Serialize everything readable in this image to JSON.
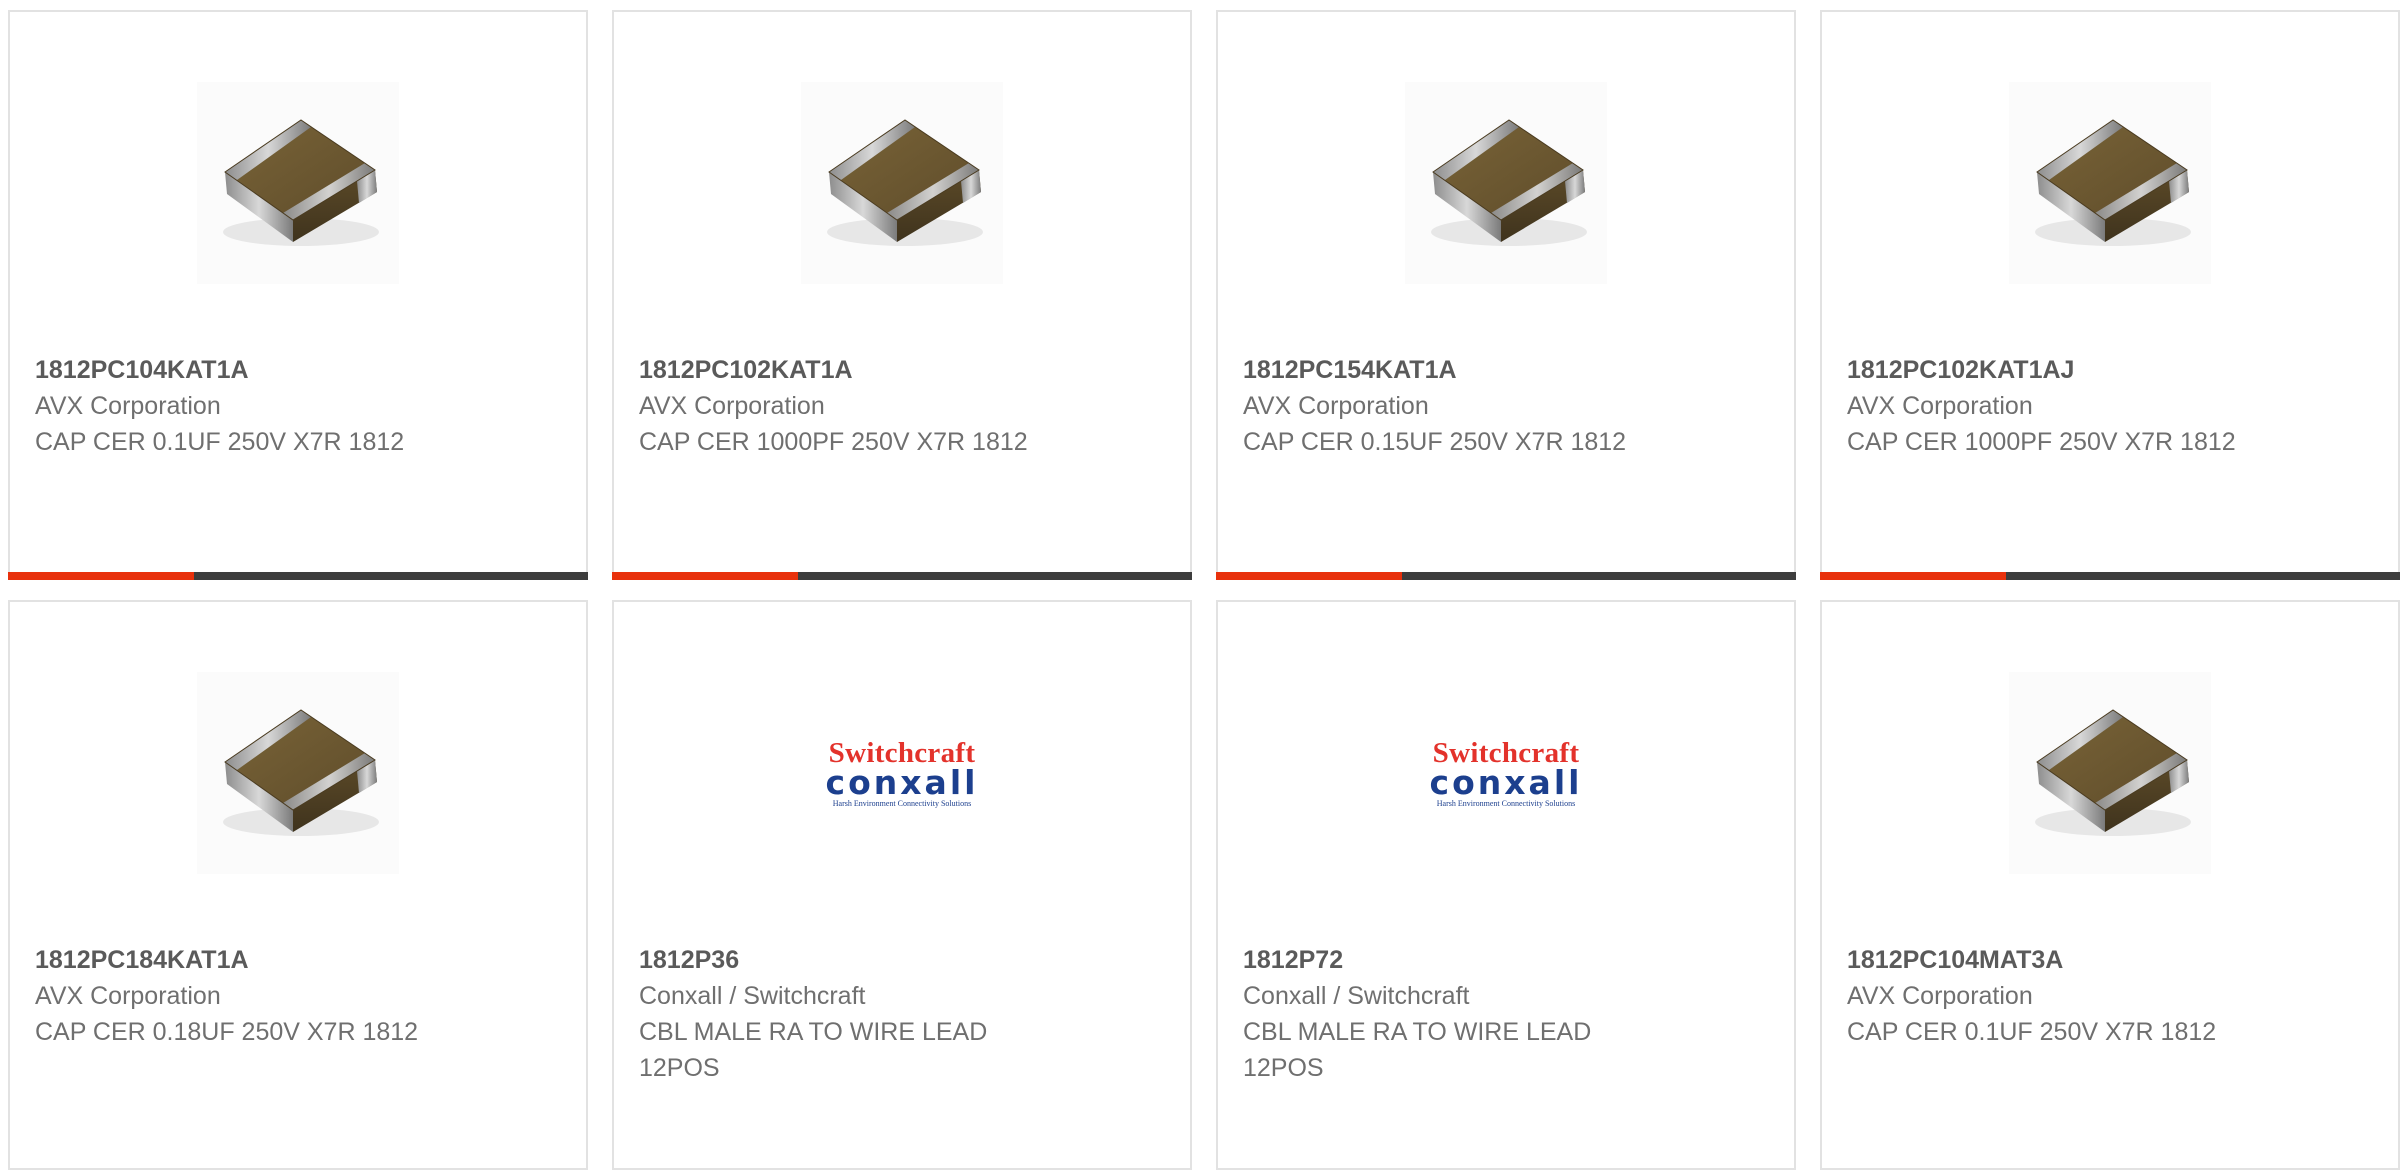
{
  "colors": {
    "accent": "#e8310c",
    "bar_track": "#3d3d3d",
    "card_border": "#e2e2e2",
    "text": "#6f6f6f"
  },
  "products": [
    {
      "part_number": "1812PC104KAT1A",
      "manufacturer": "AVX Corporation",
      "description": "CAP CER 0.1UF 250V X7R 1812",
      "image": "ceramic-capacitor-image",
      "progress": 0.32
    },
    {
      "part_number": "1812PC102KAT1A",
      "manufacturer": "AVX Corporation",
      "description": "CAP CER 1000PF 250V X7R 1812",
      "image": "ceramic-capacitor-image",
      "progress": 0.32
    },
    {
      "part_number": "1812PC154KAT1A",
      "manufacturer": "AVX Corporation",
      "description": "CAP CER 0.15UF 250V X7R 1812",
      "image": "ceramic-capacitor-image",
      "progress": 0.32
    },
    {
      "part_number": "1812PC102KAT1AJ",
      "manufacturer": "AVX Corporation",
      "description": "CAP CER 1000PF 250V X7R 1812",
      "image": "ceramic-capacitor-image",
      "progress": 0.32
    },
    {
      "part_number": "1812PC184KAT1A",
      "manufacturer": "AVX Corporation",
      "description": "CAP CER 0.18UF 250V X7R 1812",
      "image": "ceramic-capacitor-image"
    },
    {
      "part_number": "1812P36",
      "manufacturer": "Conxall / Switchcraft",
      "description": "CBL MALE RA TO WIRE LEAD 12POS",
      "image": "switchcraft-conxall-logo",
      "logo": {
        "line1": "Switchcraft",
        "line2": "conxall",
        "tagline": "Harsh Environment Connectivity Solutions"
      }
    },
    {
      "part_number": "1812P72",
      "manufacturer": "Conxall / Switchcraft",
      "description": "CBL MALE RA TO WIRE LEAD 12POS",
      "image": "switchcraft-conxall-logo",
      "logo": {
        "line1": "Switchcraft",
        "line2": "conxall",
        "tagline": "Harsh Environment Connectivity Solutions"
      }
    },
    {
      "part_number": "1812PC104MAT3A",
      "manufacturer": "AVX Corporation",
      "description": "CAP CER 0.1UF 250V X7R 1812",
      "image": "ceramic-capacitor-image"
    }
  ]
}
